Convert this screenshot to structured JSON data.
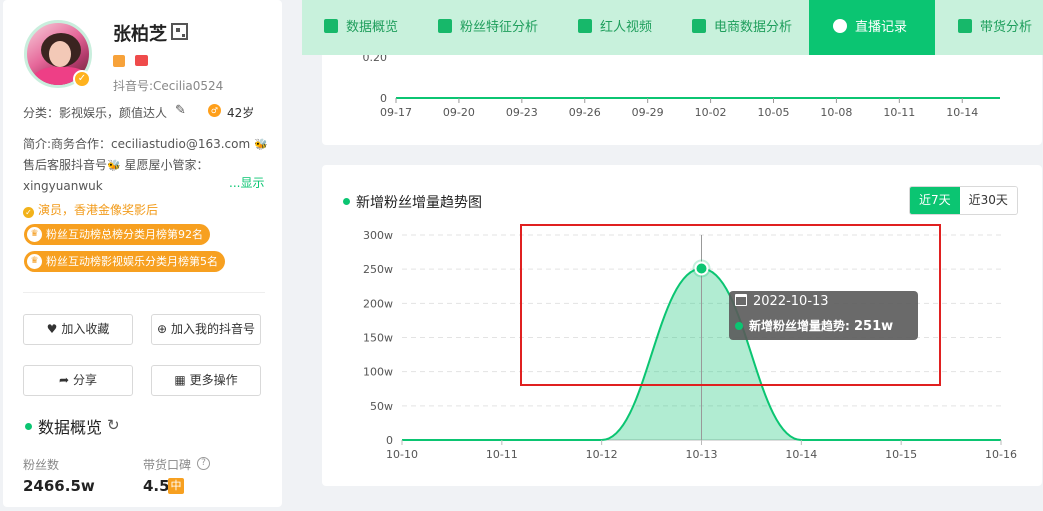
{
  "profile": {
    "name": "张柏芝",
    "douyin_id": "抖音号:Cecilia0524",
    "category": "分类：影视娱乐，颜值达人",
    "age": "42岁",
    "intro_line1": "简介:商务合作：ceciliastudio@163.com",
    "intro_line2": "售后客服抖音号",
    "intro_line2b": "星愿屋小管家：",
    "intro_line3": "xingyuanwuk",
    "show_more": "...显示",
    "honor": "演员，香港金像奖影后",
    "rank_tags": [
      "粉丝互动榜总榜分类月榜第92名",
      "粉丝互动榜影视娱乐分类月榜第5名"
    ],
    "buttons": {
      "favorite": "加入收藏",
      "add_mine": "加入我的抖音号",
      "share": "分享",
      "more": "更多操作"
    },
    "overview_title": "数据概览",
    "stats": {
      "fans_label": "粉丝数",
      "fans_value": "2466.5w",
      "rating_label": "带货口碑",
      "rating_value": "4.5",
      "rating_tier": "中"
    }
  },
  "tabs": [
    {
      "label": "数据概览",
      "icon": "pie-chart-icon"
    },
    {
      "label": "粉丝特征分析",
      "icon": "user-card-icon"
    },
    {
      "label": "红人视频",
      "icon": "video-icon"
    },
    {
      "label": "电商数据分析",
      "icon": "shopping-bag-icon"
    },
    {
      "label": "直播记录",
      "icon": "clock-icon",
      "active": true
    },
    {
      "label": "带货分析",
      "icon": "goods-icon"
    }
  ],
  "top_chart": {
    "y_ticks": [
      "0.20",
      "0"
    ],
    "x_ticks": [
      "09-17",
      "09-20",
      "09-23",
      "09-26",
      "09-29",
      "10-02",
      "10-05",
      "10-08",
      "10-11",
      "10-14"
    ]
  },
  "main_chart": {
    "title": "新增粉丝增量趋势图",
    "ranges": [
      "近7天",
      "近30天"
    ],
    "active_range": "近7天",
    "tooltip": {
      "date": "2022-10-13",
      "series_label": "新增粉丝增量趋势:",
      "value": "251w"
    }
  },
  "chart_data": {
    "type": "area",
    "title": "新增粉丝增量趋势图",
    "x": [
      "10-10",
      "10-11",
      "10-12",
      "10-13",
      "10-14",
      "10-15",
      "10-16"
    ],
    "y_tick_labels": [
      "0",
      "50w",
      "100w",
      "150w",
      "200w",
      "250w",
      "300w"
    ],
    "series": [
      {
        "values": [
          0,
          0,
          0,
          251,
          0,
          0,
          0
        ]
      }
    ],
    "ylim": [
      0,
      300
    ],
    "unit": "w",
    "grid": true,
    "highlighted_point": {
      "x": "10-13",
      "y": 251
    },
    "color": "#0bc572"
  },
  "colors": {
    "accent": "#0bc572",
    "tab_bg": "#c8f1dc",
    "highlight": "#e02020",
    "tag": "#f7a020"
  }
}
